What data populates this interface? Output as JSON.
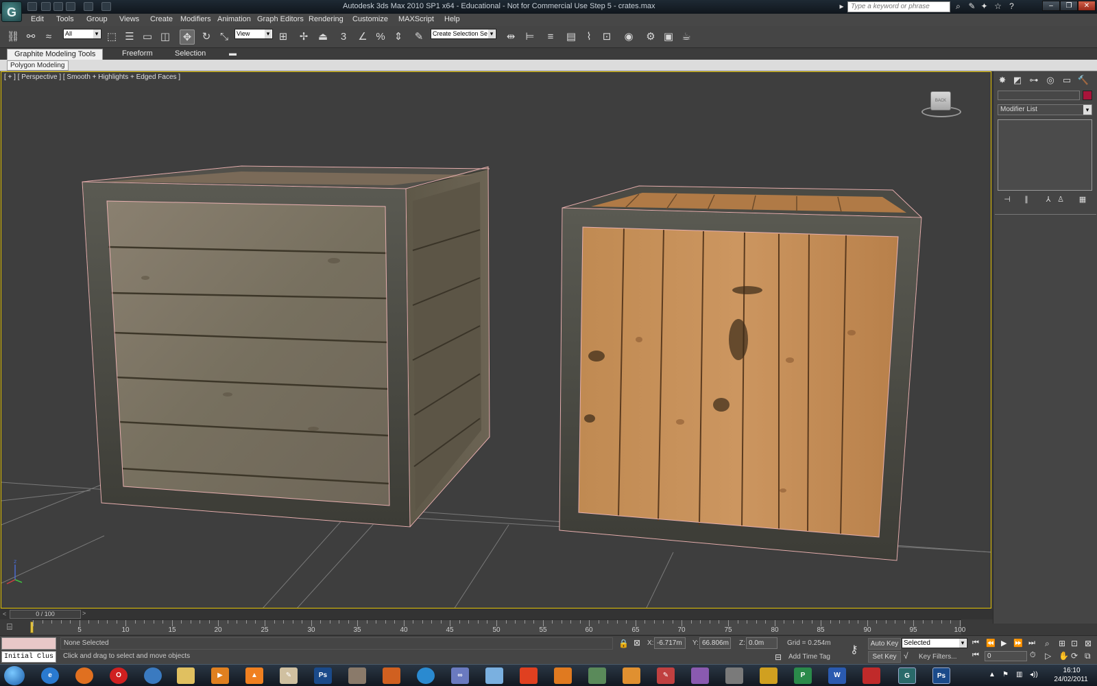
{
  "window": {
    "title": "Autodesk 3ds Max  2010 SP1 x64 - Educational - Not for Commercial Use      Step 5 - crates.max",
    "search_placeholder": "Type a keyword or phrase"
  },
  "menu": [
    "Edit",
    "Tools",
    "Group",
    "Views",
    "Create",
    "Modifiers",
    "Animation",
    "Graph Editors",
    "Rendering",
    "Customize",
    "MAXScript",
    "Help"
  ],
  "toolbar": {
    "selection_filter": "All",
    "ref_coord": "View",
    "snap_label": "3",
    "named_selection": "Create Selection Se"
  },
  "ribbon": {
    "tabs": [
      "Graphite Modeling Tools",
      "Freeform",
      "Selection"
    ],
    "panel_tab": "Polygon Modeling"
  },
  "viewport": {
    "label": "[ + ] [ Perspective ] [ Smooth + Highlights + Edged Faces ]",
    "viewcube_face": "BACK"
  },
  "command_panel": {
    "modifier_list": "Modifier List"
  },
  "timeline": {
    "slider": "0 / 100",
    "ticks": [
      5,
      10,
      15,
      20,
      25,
      30,
      35,
      40,
      45,
      50,
      55,
      60,
      65,
      70,
      75,
      80,
      85,
      90,
      95,
      100
    ],
    "max_frame": 100
  },
  "status": {
    "cluster_input": "Initial Clus",
    "selection": "None Selected",
    "prompt": "Click and drag to select and move objects",
    "x_label": "X:",
    "x": "-6.717m",
    "y_label": "Y:",
    "y": "66.806m",
    "z_label": "Z:",
    "z": "0.0m",
    "grid": "Grid = 0.254m",
    "add_time_tag": "Add Time Tag",
    "auto_key": "Auto Key",
    "set_key": "Set Key",
    "key_mode": "Selected",
    "key_filters": "Key Filters...",
    "frame": "0"
  },
  "taskbar": {
    "ps_label": "Ps",
    "word_label": "W",
    "time": "16:10",
    "date": "24/02/2011"
  },
  "colors": {
    "viewport_border": "#e0c000",
    "object_color": "#a8143a",
    "selection_edges": "#e8b0b0"
  }
}
